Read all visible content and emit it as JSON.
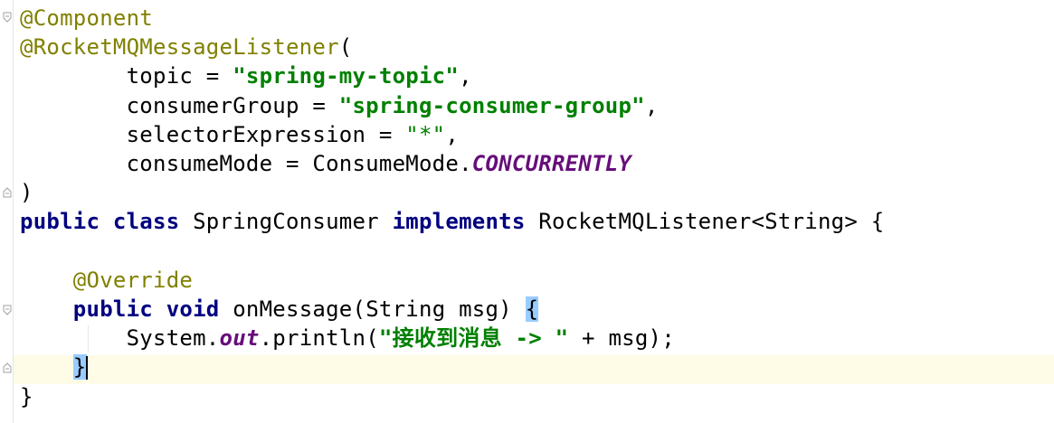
{
  "editor": {
    "lines": [
      {
        "tokens": [
          {
            "t": "@Component",
            "c": "ann"
          }
        ]
      },
      {
        "tokens": [
          {
            "t": "@RocketMQMessageListener",
            "c": "ann"
          },
          {
            "t": "(",
            "c": "plain"
          }
        ]
      },
      {
        "tokens": [
          {
            "t": "        topic = ",
            "c": "plain"
          },
          {
            "t": "\"spring-my-topic\"",
            "c": "str"
          },
          {
            "t": ",",
            "c": "plain"
          }
        ]
      },
      {
        "tokens": [
          {
            "t": "        consumerGroup = ",
            "c": "plain"
          },
          {
            "t": "\"spring-consumer-group\"",
            "c": "str"
          },
          {
            "t": ",",
            "c": "plain"
          }
        ]
      },
      {
        "tokens": [
          {
            "t": "        selectorExpression = ",
            "c": "plain"
          },
          {
            "t": "\"*\"",
            "c": "plainstr"
          },
          {
            "t": ",",
            "c": "plain"
          }
        ]
      },
      {
        "tokens": [
          {
            "t": "        consumeMode = ConsumeMode.",
            "c": "plain"
          },
          {
            "t": "CONCURRENTLY",
            "c": "static"
          }
        ]
      },
      {
        "tokens": [
          {
            "t": ")",
            "c": "plain"
          }
        ]
      },
      {
        "tokens": [
          {
            "t": "public class",
            "c": "kw"
          },
          {
            "t": " SpringConsumer ",
            "c": "plain"
          },
          {
            "t": "implements",
            "c": "kw"
          },
          {
            "t": " RocketMQListener<String> {",
            "c": "plain"
          }
        ]
      },
      {
        "tokens": []
      },
      {
        "tokens": [
          {
            "t": "    ",
            "c": "plain"
          },
          {
            "t": "@Override",
            "c": "ann"
          }
        ]
      },
      {
        "tokens": [
          {
            "t": "    ",
            "c": "plain"
          },
          {
            "t": "public void",
            "c": "kw"
          },
          {
            "t": " onMessage(String msg) ",
            "c": "plain"
          },
          {
            "t": "{",
            "c": "brace"
          }
        ]
      },
      {
        "tokens": [
          {
            "t": "        System.",
            "c": "plain"
          },
          {
            "t": "out",
            "c": "field"
          },
          {
            "t": ".println(",
            "c": "plain"
          },
          {
            "t": "\"接收到消息 -> \"",
            "c": "str"
          },
          {
            "t": " + msg);",
            "c": "plain"
          }
        ]
      },
      {
        "tokens": [
          {
            "t": "    ",
            "c": "plain"
          },
          {
            "t": "}",
            "c": "brace"
          },
          {
            "t": "",
            "c": "caret"
          }
        ]
      },
      {
        "tokens": [
          {
            "t": "}",
            "c": "plain"
          }
        ]
      }
    ],
    "fold_markers": [
      "fold-open",
      "fold-close",
      "fold-open",
      "fold-close"
    ],
    "colors": {
      "annotation": "#808000",
      "keyword": "#000080",
      "string": "#008000",
      "static_field": "#660e7a",
      "caret_row": "#fefce7",
      "brace_match": "#99ccff"
    }
  }
}
